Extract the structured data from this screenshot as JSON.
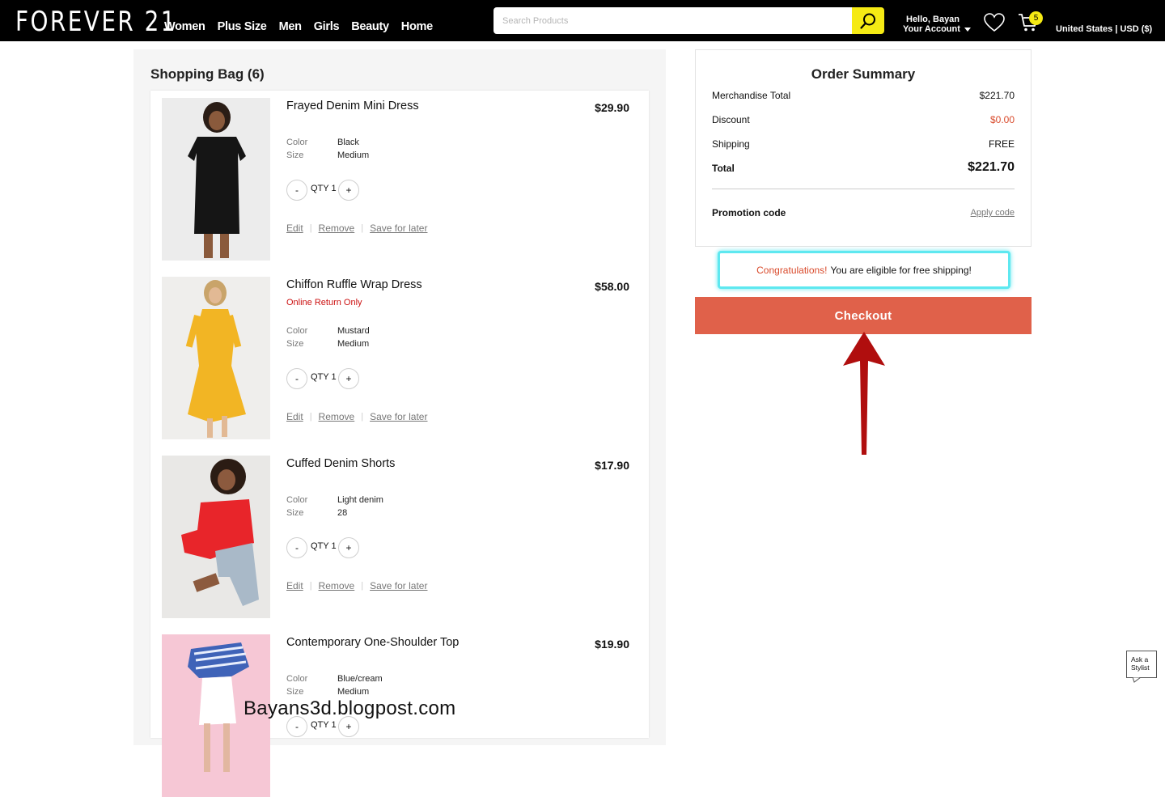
{
  "header": {
    "logo": "FOREVER 21",
    "nav": [
      "Women",
      "Plus Size",
      "Men",
      "Girls",
      "Beauty",
      "Home"
    ],
    "search_placeholder": "Search Products",
    "greeting": "Hello, Bayan",
    "account_label": "Your Account",
    "cart_count": "5",
    "region": "United States | USD ($)"
  },
  "bag": {
    "title": "Shopping Bag (6)",
    "color_label": "Color",
    "size_label": "Size",
    "qty_label": "QTY 1",
    "minus": "-",
    "plus": "+",
    "edit": "Edit",
    "remove": "Remove",
    "save_later": "Save for later",
    "sep": "|",
    "items": [
      {
        "name": "Frayed Denim Mini Dress",
        "price": "$29.90",
        "note": "",
        "color": "Black",
        "size": "Medium"
      },
      {
        "name": "Chiffon Ruffle Wrap Dress",
        "price": "$58.00",
        "note": "Online Return Only",
        "color": "Mustard",
        "size": "Medium"
      },
      {
        "name": "Cuffed Denim Shorts",
        "price": "$17.90",
        "note": "",
        "color": "Light denim",
        "size": "28"
      },
      {
        "name": "Contemporary One-Shoulder Top",
        "price": "$19.90",
        "note": "",
        "color": "Blue/cream",
        "size": "Medium"
      }
    ]
  },
  "summary": {
    "title": "Order Summary",
    "merch_label": "Merchandise Total",
    "merch_value": "$221.70",
    "discount_label": "Discount",
    "discount_value": "$0.00",
    "shipping_label": "Shipping",
    "shipping_value": "FREE",
    "total_label": "Total",
    "total_value": "$221.70",
    "promo_label": "Promotion code",
    "promo_link": "Apply code",
    "congrats_highlight": "Congratulations!",
    "congrats_text": "You are eligible for free shipping!",
    "checkout": "Checkout"
  },
  "ask_stylist": "Ask a Stylist",
  "watermark": "Bayans3d.blogpost.com",
  "colors": {
    "accent_yellow": "#f5ea14",
    "checkout_bg": "#e0614a",
    "highlight_cyan": "#5ee8f0",
    "arrow_red": "#b00e0e",
    "note_red": "#cc1111"
  }
}
